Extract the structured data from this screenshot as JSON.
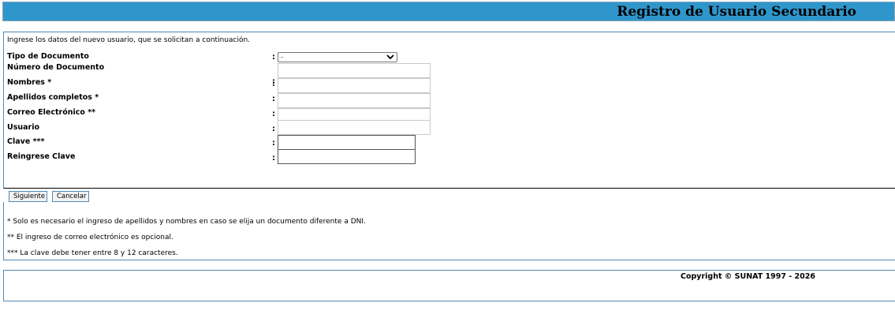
{
  "header": {
    "title": "Registro de Usuario Secundario"
  },
  "form": {
    "intro": "Ingrese los datos del nuevo usuario, que se solicitan a continuación.",
    "colon": ":",
    "tipo_documento": {
      "label": "Tipo de Documento",
      "selected": "-"
    },
    "numero_documento": {
      "label": "Número de Documento",
      "value": ""
    },
    "nombres": {
      "label": "Nombres *",
      "value": ""
    },
    "apellidos": {
      "label": "Apellidos completos *",
      "value": ""
    },
    "correo": {
      "label": "Correo Electrónico **",
      "value": ""
    },
    "usuario": {
      "label": "Usuario",
      "value": ""
    },
    "clave": {
      "label": "Clave ***",
      "value": ""
    },
    "reingrese_clave": {
      "label": "Reingrese Clave",
      "value": ""
    }
  },
  "buttons": {
    "siguiente": "Siguiente",
    "cancelar": "Cancelar"
  },
  "notes": [
    "* Solo es necesario el ingreso de apellidos y nombres en caso se elija un documento diferente a DNI.",
    "** El ingreso de correo electrónico es opcional.",
    "*** La clave debe tener entre 8 y 12 caracteres."
  ],
  "footer": {
    "copyright": "Copyright © SUNAT 1997 - 2026"
  },
  "colors": {
    "header_bg": "#2f96cc",
    "border": "#4f8ab8"
  }
}
